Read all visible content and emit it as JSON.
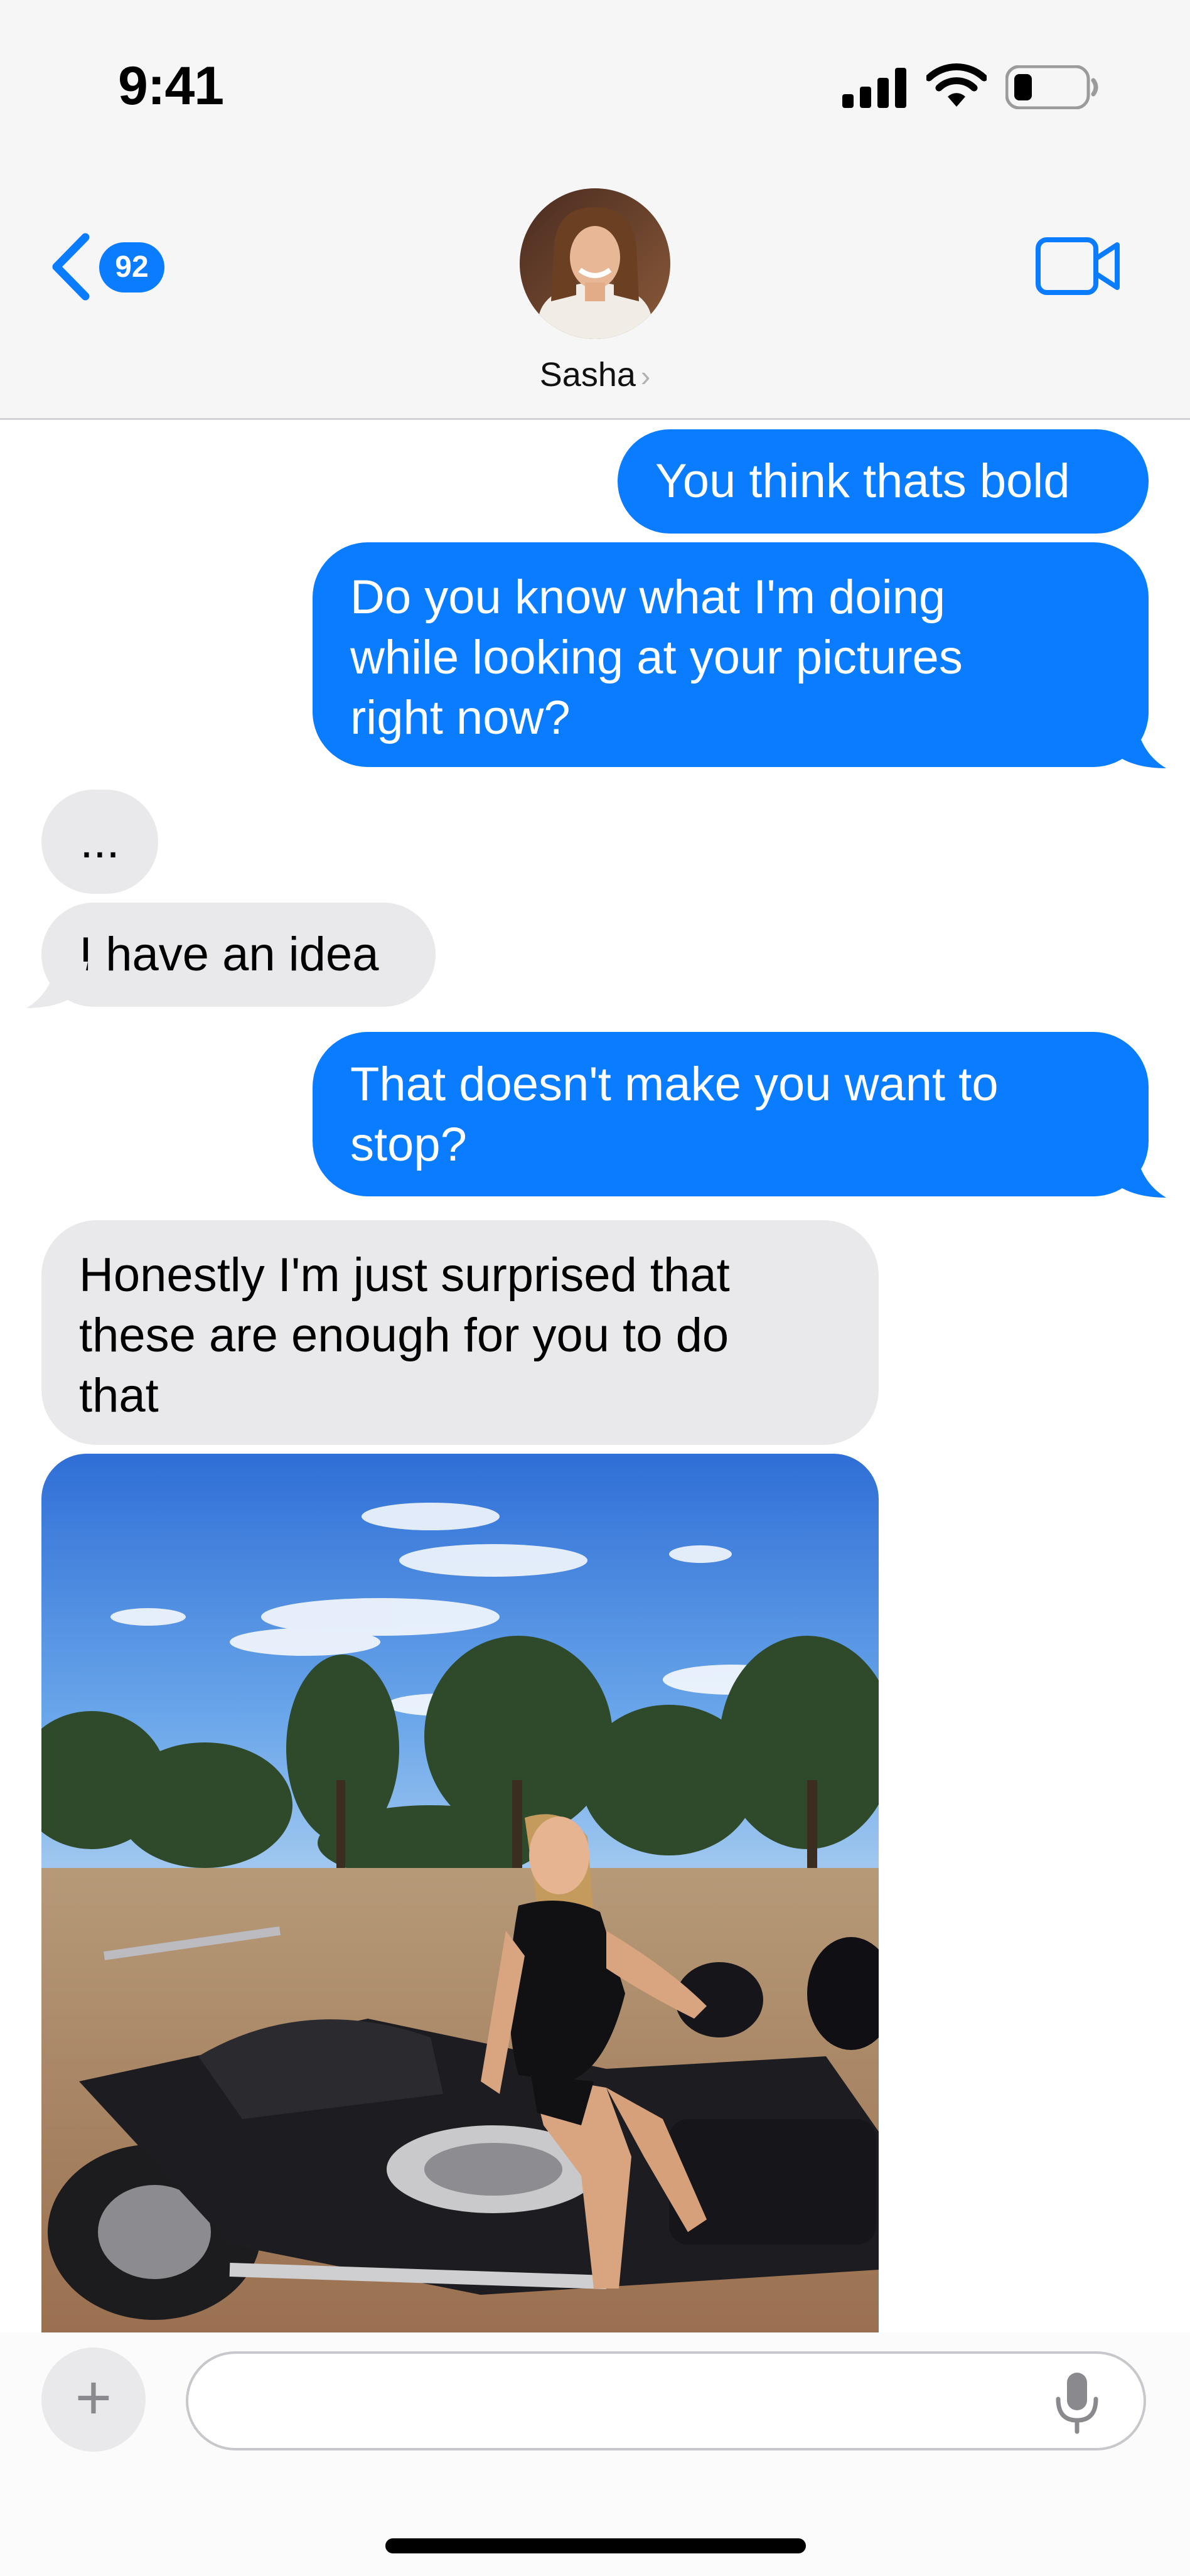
{
  "status_bar": {
    "time": "9:41"
  },
  "header": {
    "back_badge_count": "92",
    "contact_name": "Sasha",
    "name_chevron": "›",
    "icons": [
      "chevron-left-icon",
      "video-camera-icon"
    ]
  },
  "messages": [
    {
      "side": "outgoing",
      "text": "You think thats bold"
    },
    {
      "side": "outgoing",
      "lines": [
        "Do you know what I'm doing",
        "while looking at your pictures",
        "right now?"
      ]
    },
    {
      "side": "incoming",
      "text": "..."
    },
    {
      "side": "incoming",
      "text": "I have an idea"
    },
    {
      "side": "outgoing",
      "lines": [
        "That doesn't make you want to",
        "stop?"
      ]
    },
    {
      "side": "incoming",
      "lines": [
        "Honestly I'm just surprised that",
        "these are enough for you to do",
        "that"
      ]
    },
    {
      "side": "incoming",
      "type": "photo"
    }
  ],
  "composer": {
    "plus_label": "+",
    "placeholder": "",
    "icons": [
      "plus-icon",
      "microphone-icon"
    ]
  },
  "colors": {
    "outgoing_bubble": "#0a7cff",
    "incoming_bubble": "#e9e9eb",
    "header_bg": "#f6f6f6"
  }
}
